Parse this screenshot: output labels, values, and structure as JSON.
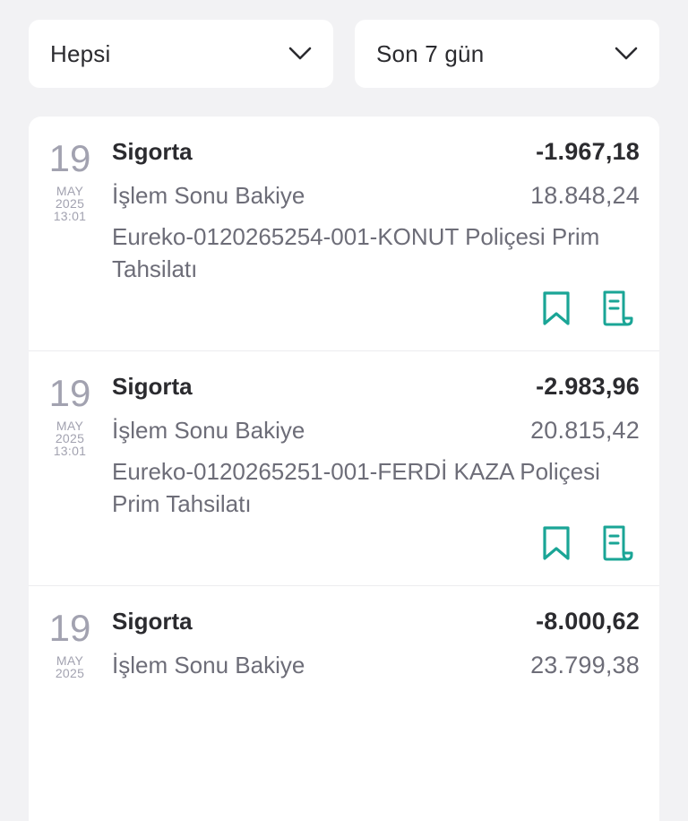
{
  "filters": {
    "category": "Hepsi",
    "period": "Son 7 gün"
  },
  "transactions": [
    {
      "day": "19",
      "month": "MAY",
      "year": "2025",
      "time": "13:01",
      "title": "Sigorta",
      "amount": "-1.967,18",
      "balance_label": "İşlem Sonu Bakiye",
      "balance": "18.848,24",
      "description": "Eureko-0120265254-001-KONUT Poliçesi Prim Tahsilatı"
    },
    {
      "day": "19",
      "month": "MAY",
      "year": "2025",
      "time": "13:01",
      "title": "Sigorta",
      "amount": "-2.983,96",
      "balance_label": "İşlem Sonu Bakiye",
      "balance": "20.815,42",
      "description": "Eureko-0120265251-001-FERDİ KAZA Poliçesi Prim Tahsilatı"
    },
    {
      "day": "19",
      "month": "MAY",
      "year": "2025",
      "time": "",
      "title": "Sigorta",
      "amount": "-8.000,62",
      "balance_label": "İşlem Sonu Bakiye",
      "balance": "23.799,38",
      "description": ""
    }
  ],
  "icons": {
    "bookmark": "bookmark-icon",
    "receipt": "receipt-icon",
    "dropdown": "chevron-down-icon"
  },
  "colors": {
    "background": "#f2f2f4",
    "card": "#ffffff",
    "accent": "#1aa596",
    "text_primary": "#2b2b2f",
    "text_secondary": "#6d6d78",
    "date_text": "#a2a2b0"
  }
}
